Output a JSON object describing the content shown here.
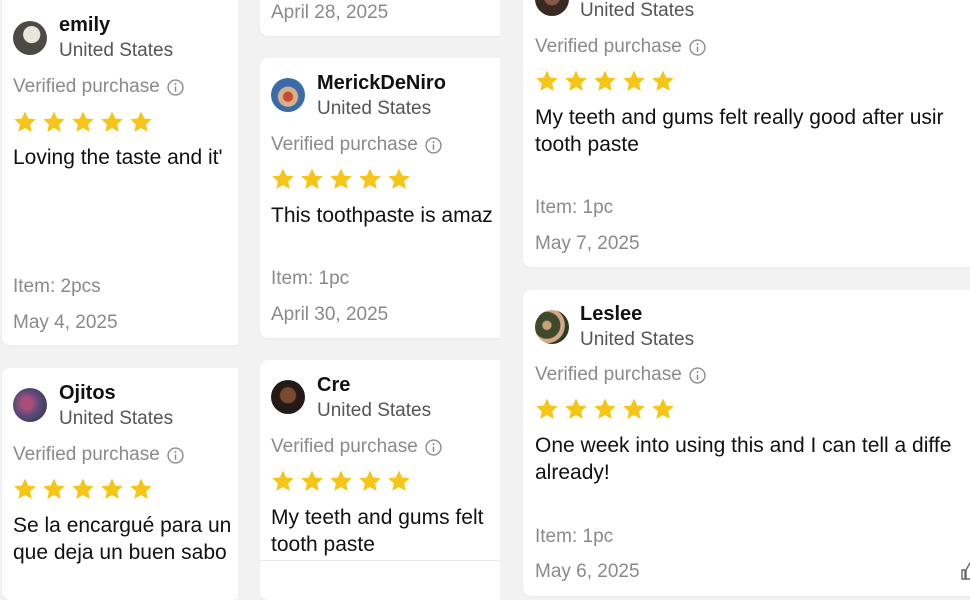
{
  "colors": {
    "star": "#F5C518",
    "muted": "#8a8a8a",
    "text": "#111111"
  },
  "rating_max": 5,
  "reviews": [
    {
      "name": "emily",
      "country": "United States",
      "verified": "Verified purchase",
      "rating": 5,
      "text_lines": [
        "Loving the taste and it'"
      ],
      "item": "Item: 2pcs",
      "date": "May 4, 2025"
    },
    {
      "name": "Ojitos",
      "country": "United States",
      "verified": "Verified purchase",
      "rating": 5,
      "text_lines": [
        "Se la encargué para un",
        "que deja un buen sabo"
      ]
    },
    {
      "date": "April 28, 2025"
    },
    {
      "name": "MerickDeNiro",
      "country": "United States",
      "verified": "Verified purchase",
      "rating": 5,
      "text_lines": [
        "This toothpaste is amaz"
      ],
      "item": "Item: 1pc",
      "date": "April 30, 2025"
    },
    {
      "name": "Cre",
      "country": "United States",
      "verified": "Verified purchase",
      "rating": 5,
      "text_lines": [
        "My teeth and gums felt",
        "tooth paste"
      ]
    },
    {
      "country": "United States",
      "verified": "Verified purchase",
      "rating": 5,
      "text_lines": [
        "My teeth and gums felt really good after usir",
        "tooth paste"
      ],
      "item": "Item: 1pc",
      "date": "May 7, 2025"
    },
    {
      "name": "Leslee",
      "country": "United States",
      "verified": "Verified purchase",
      "rating": 5,
      "text_lines": [
        "One week into using this and I can tell a diffe",
        "already!"
      ],
      "item": "Item: 1pc",
      "date": "May 6, 2025"
    }
  ]
}
